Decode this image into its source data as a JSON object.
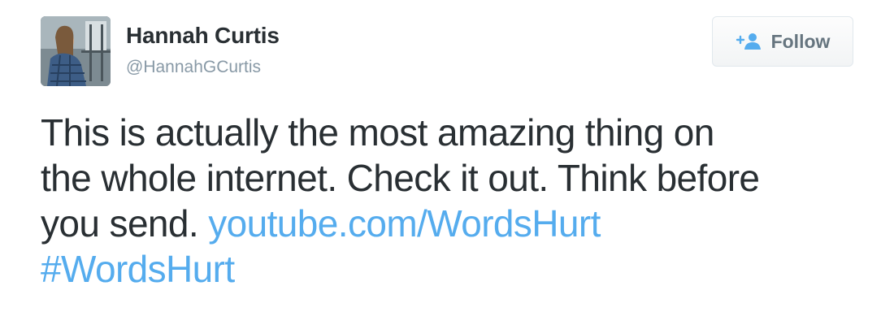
{
  "user": {
    "display_name": "Hannah Curtis",
    "handle": "@HannahGCurtis"
  },
  "follow_button": {
    "label": "Follow",
    "icon": "add-user-icon"
  },
  "tweet": {
    "lines": [
      "This is actually the most amazing thing on",
      "the whole internet. Check it out. Think before",
      "you send. "
    ],
    "link_text": "youtube.com/WordsHurt",
    "hashtag": "#WordsHurt"
  },
  "colors": {
    "link": "#55acee",
    "text": "#292f33",
    "muted": "#8899a6"
  }
}
